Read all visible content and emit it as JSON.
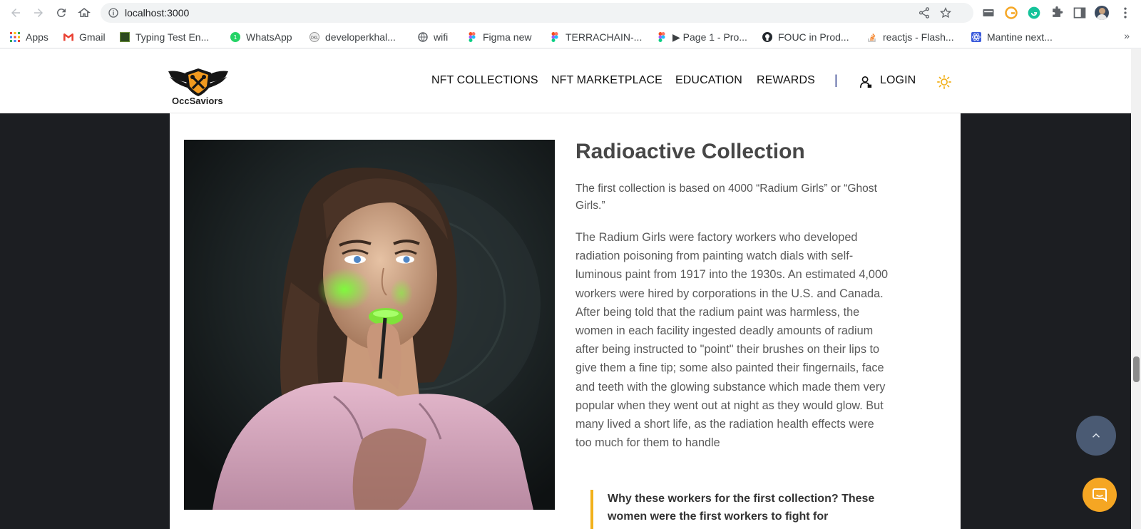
{
  "browser": {
    "url": "localhost:3000",
    "bookmarks": [
      {
        "label": "Apps",
        "icon": "apps-grid-icon"
      },
      {
        "label": "Gmail",
        "icon": "gmail-icon"
      },
      {
        "label": "Typing Test En...",
        "icon": "typing-test-icon"
      },
      {
        "label": "WhatsApp",
        "icon": "whatsapp-icon"
      },
      {
        "label": "developerkhal...",
        "icon": "developer-icon"
      },
      {
        "label": "wifi",
        "icon": "globe-icon"
      },
      {
        "label": "Figma new",
        "icon": "figma-icon"
      },
      {
        "label": "TERRACHAIN-...",
        "icon": "figma-icon"
      },
      {
        "label": "▶ Page 1 - Pro...",
        "icon": "figma-icon"
      },
      {
        "label": "FOUC in Prod...",
        "icon": "github-icon"
      },
      {
        "label": "reactjs - Flash...",
        "icon": "stackoverflow-icon"
      },
      {
        "label": "Mantine next...",
        "icon": "react-icon"
      }
    ],
    "more_label": "»"
  },
  "site": {
    "brand": "OccSaviors",
    "nav": {
      "nft_collections": "NFT COLLECTIONS",
      "nft_marketplace": "NFT MARKETPLACE",
      "education": "EDUCATION",
      "rewards": "REWARDS",
      "separator": "|",
      "login": "LOGIN"
    },
    "accent_color": "#f2b11b"
  },
  "content": {
    "title": "Radioactive Collection",
    "lead": "The first collection is based on 4000 “Radium Girls” or “Ghost Girls.”",
    "body": "The Radium Girls were factory workers who developed radiation poisoning from painting watch dials with self-luminous paint from 1917 into the 1930s. An estimated 4,000 workers were hired by corporations in the U.S. and Canada. After being told that the radium paint was harmless, the women in each facility ingested deadly amounts of radium after being instructed to \"point\" their brushes on their lips to give them a fine tip; some also painted their fingernails, face and teeth with the glowing substance which made them very popular when they went out at night as they would glow. But many lived a short life, as the radiation health effects were too much for them to handle",
    "quote": "Why these workers for the first collection? These women were the first workers to fight for"
  }
}
